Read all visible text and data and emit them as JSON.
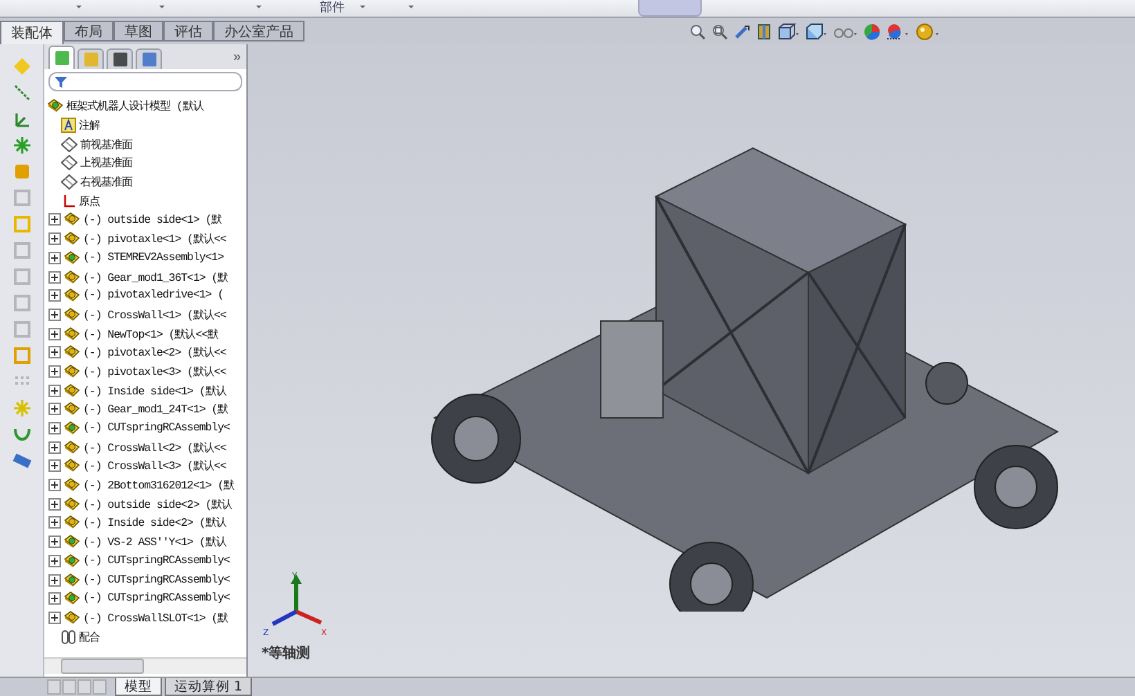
{
  "top_strip": {
    "label": "部件"
  },
  "command_tabs": [
    {
      "label": "装配体",
      "selected": true
    },
    {
      "label": "布局",
      "selected": false
    },
    {
      "label": "草图",
      "selected": false
    },
    {
      "label": "评估",
      "selected": false
    },
    {
      "label": "办公室产品",
      "selected": false
    }
  ],
  "left_toolbar": [
    {
      "kind": "mate",
      "disabled": false
    },
    {
      "kind": "line",
      "disabled": false
    },
    {
      "kind": "axes",
      "disabled": false
    },
    {
      "kind": "star",
      "disabled": false
    },
    {
      "kind": "clip",
      "disabled": false
    },
    {
      "kind": "copy",
      "disabled": true
    },
    {
      "kind": "box",
      "disabled": false
    },
    {
      "kind": "shell",
      "disabled": true
    },
    {
      "kind": "layer",
      "disabled": true
    },
    {
      "kind": "cube",
      "disabled": true
    },
    {
      "kind": "layer",
      "disabled": true
    },
    {
      "kind": "frame",
      "disabled": false
    },
    {
      "kind": "pattern",
      "disabled": true
    },
    {
      "kind": "explode",
      "disabled": false
    },
    {
      "kind": "curve",
      "disabled": false
    },
    {
      "kind": "ruler",
      "disabled": false
    }
  ],
  "panel_tabs": [
    {
      "kind": "tree",
      "selected": true
    },
    {
      "kind": "property",
      "selected": false
    },
    {
      "kind": "config",
      "selected": false
    },
    {
      "kind": "display",
      "selected": false
    }
  ],
  "panel_more": "»",
  "tree": {
    "label": "框架式机器人设计模型 (默认",
    "children": [
      {
        "kind": "annotation",
        "label": "注解"
      },
      {
        "kind": "plane",
        "label": "前视基准面"
      },
      {
        "kind": "plane",
        "label": "上视基准面"
      },
      {
        "kind": "plane",
        "label": "右视基准面"
      },
      {
        "kind": "origin",
        "label": "原点"
      },
      {
        "kind": "part",
        "label": "(-) outside side<1> (默",
        "expanded": false
      },
      {
        "kind": "part",
        "label": "(-) pivotaxle<1> (默认<<",
        "expanded": false
      },
      {
        "kind": "assembly",
        "label": "(-) STEMREV2Assembly<1>",
        "expanded": false
      },
      {
        "kind": "part",
        "label": "(-) Gear_mod1_36T<1> (默",
        "expanded": false
      },
      {
        "kind": "part",
        "label": "(-) pivotaxledrive<1> (",
        "expanded": false
      },
      {
        "kind": "part",
        "label": "(-) CrossWall<1> (默认<<",
        "expanded": false
      },
      {
        "kind": "part",
        "label": "(-) NewTop<1> (默认<<默",
        "expanded": false
      },
      {
        "kind": "part",
        "label": "(-) pivotaxle<2> (默认<<",
        "expanded": false
      },
      {
        "kind": "part",
        "label": "(-) pivotaxle<3> (默认<<",
        "expanded": false
      },
      {
        "kind": "part",
        "label": "(-) Inside side<1> (默认",
        "expanded": false
      },
      {
        "kind": "part",
        "label": "(-) Gear_mod1_24T<1> (默",
        "expanded": false
      },
      {
        "kind": "assembly",
        "label": "(-) CUTspringRCAssembly<",
        "expanded": false
      },
      {
        "kind": "part",
        "label": "(-) CrossWall<2> (默认<<",
        "expanded": false
      },
      {
        "kind": "part",
        "label": "(-) CrossWall<3> (默认<<",
        "expanded": false
      },
      {
        "kind": "part",
        "label": "(-) 2Bottom3162012<1> (默",
        "expanded": false
      },
      {
        "kind": "part",
        "label": "(-) outside side<2> (默认",
        "expanded": false
      },
      {
        "kind": "part",
        "label": "(-) Inside side<2> (默认",
        "expanded": false
      },
      {
        "kind": "assembly",
        "label": "(-) VS-2 ASS''Y<1> (默认",
        "expanded": false
      },
      {
        "kind": "assembly",
        "label": "(-) CUTspringRCAssembly<",
        "expanded": false
      },
      {
        "kind": "assembly",
        "label": "(-) CUTspringRCAssembly<",
        "expanded": false
      },
      {
        "kind": "assembly",
        "label": "(-) CUTspringRCAssembly<",
        "expanded": false
      },
      {
        "kind": "part",
        "label": "(-) CrossWallSLOT<1> (默",
        "expanded": false
      },
      {
        "kind": "mates",
        "label": "配合"
      }
    ]
  },
  "view_label": "*等轴测",
  "triad": {
    "x": "X",
    "y": "Y",
    "z": "Z"
  },
  "bottom_tabs": [
    {
      "label": "模型",
      "selected": true
    },
    {
      "label": "运动算例 1",
      "selected": false
    }
  ]
}
